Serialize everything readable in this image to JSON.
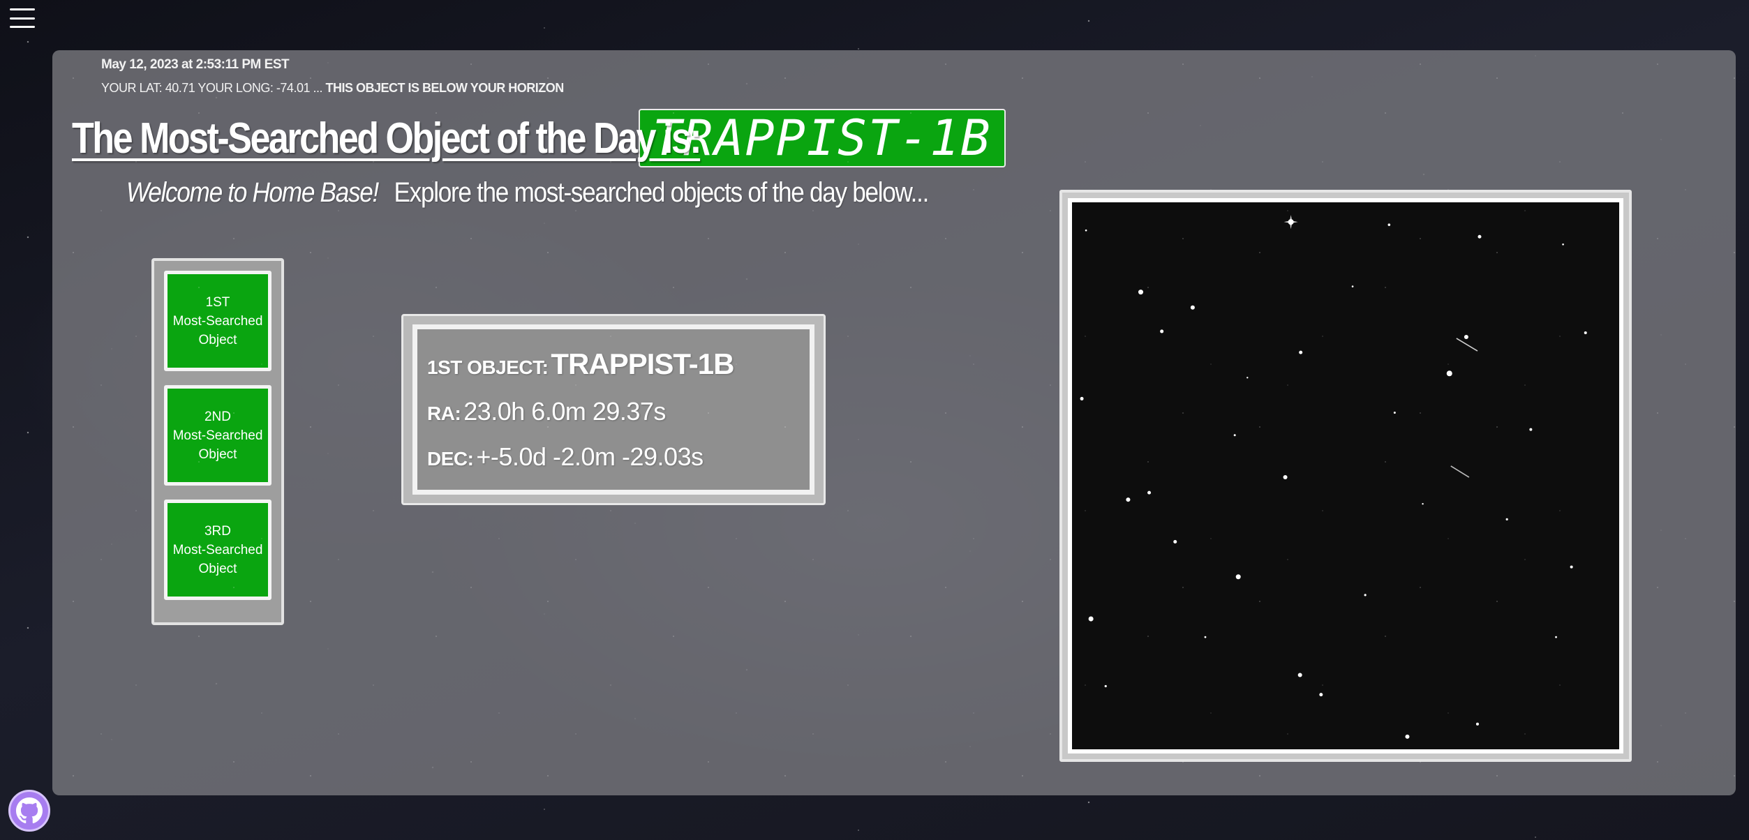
{
  "header": {
    "timestamp": "May 12, 2023 at 2:53:11 PM EST",
    "location_text": "YOUR LAT: 40.71 YOUR LONG: -74.01 ...",
    "horizon_status": "THIS OBJECT IS BELOW YOUR HORIZON"
  },
  "headline": {
    "title": "The Most-Searched Object of the Day is:",
    "object_name": "TRAPPIST-1B"
  },
  "welcome": {
    "greeting": "Welcome to Home Base!",
    "subtitle": "Explore the most-searched objects of the day below..."
  },
  "rank_buttons": [
    {
      "line1": "1ST",
      "line2": "Most-Searched",
      "line3": "Object"
    },
    {
      "line1": "2ND",
      "line2": "Most-Searched",
      "line3": "Object"
    },
    {
      "line1": "3RD",
      "line2": "Most-Searched",
      "line3": "Object"
    }
  ],
  "object_info": {
    "object_label": "1ST OBJECT:",
    "object_value": "TRAPPIST-1B",
    "ra_label": "RA:",
    "ra_value": "23.0h 6.0m 29.37s",
    "dec_label": "DEC:",
    "dec_value": "+-5.0d -2.0m -29.03s"
  },
  "icons": {
    "menu": "hamburger-menu-icon",
    "github": "github-icon"
  },
  "colors": {
    "accent_green": "#0aa510",
    "panel_gray": "#76767c",
    "github_purple": "#a77df0"
  }
}
